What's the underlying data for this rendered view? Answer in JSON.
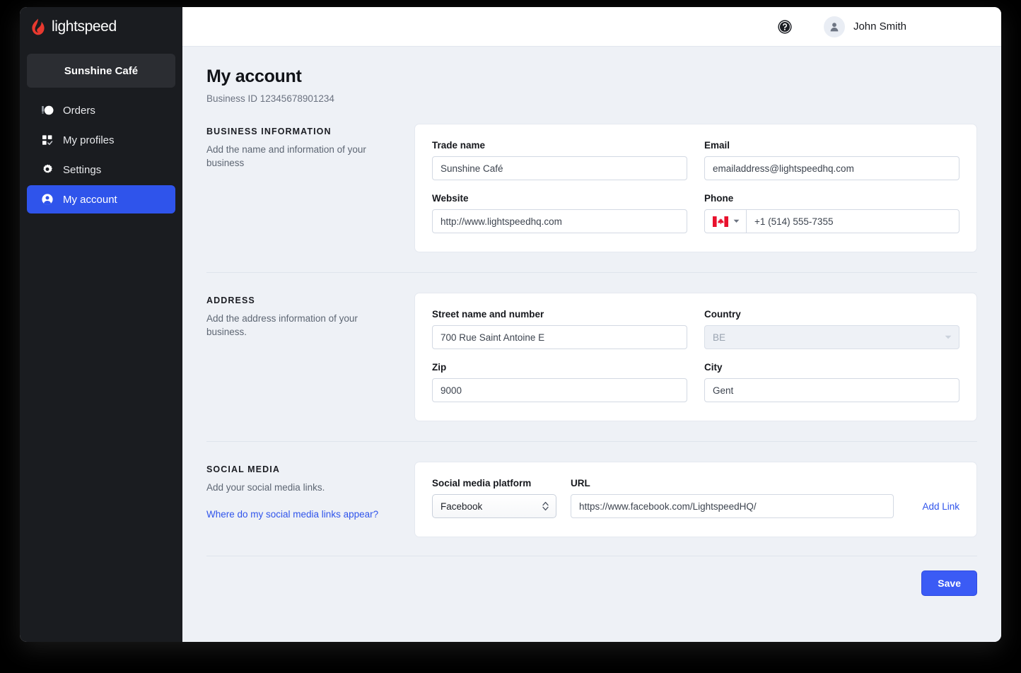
{
  "sidebar": {
    "brand": "lightspeed",
    "brand_color": "#e8392f",
    "store_name": "Sunshine Café",
    "active_color": "#2f54eb",
    "items": [
      {
        "label": "Orders",
        "icon": "orders-icon",
        "active": false
      },
      {
        "label": "My profiles",
        "icon": "profiles-icon",
        "active": false
      },
      {
        "label": "Settings",
        "icon": "gear-icon",
        "active": false
      },
      {
        "label": "My account",
        "icon": "account-icon",
        "active": true
      }
    ]
  },
  "topbar": {
    "help_icon": "help-circle-icon",
    "avatar_icon": "user-avatar-icon",
    "user_name": "John Smith"
  },
  "page": {
    "title": "My account",
    "subtitle": "Business ID 12345678901234"
  },
  "business": {
    "section_title": "Business information",
    "section_desc": "Add the name and information of your business",
    "trade_name_label": "Trade name",
    "trade_name_value": "Sunshine Café",
    "email_label": "Email",
    "email_value": "emailaddress@lightspeedhq.com",
    "website_label": "Website",
    "website_value": "http://www.lightspeedhq.com",
    "phone_label": "Phone",
    "phone_value": "+1 (514) 555-7355",
    "phone_country_flag": "canada-flag-icon"
  },
  "address": {
    "section_title": "Address",
    "section_desc": "Add the address information of your business.",
    "street_label": "Street name and number",
    "street_value": "700 Rue Saint Antoine E",
    "country_label": "Country",
    "country_value": "BE",
    "country_options": [
      "BE"
    ],
    "zip_label": "Zip",
    "zip_value": "9000",
    "city_label": "City",
    "city_value": "Gent"
  },
  "social": {
    "section_title": "Social media",
    "section_desc": "Add your social media links.",
    "help_link": "Where do my social media links appear?",
    "platform_label": "Social media platform",
    "platform_value": "Facebook",
    "platform_options": [
      "Facebook"
    ],
    "url_label": "URL",
    "url_value": "https://www.facebook.com/LightspeedHQ/",
    "add_link_label": "Add Link"
  },
  "footer": {
    "save_label": "Save",
    "save_color": "#3b5bf5"
  }
}
